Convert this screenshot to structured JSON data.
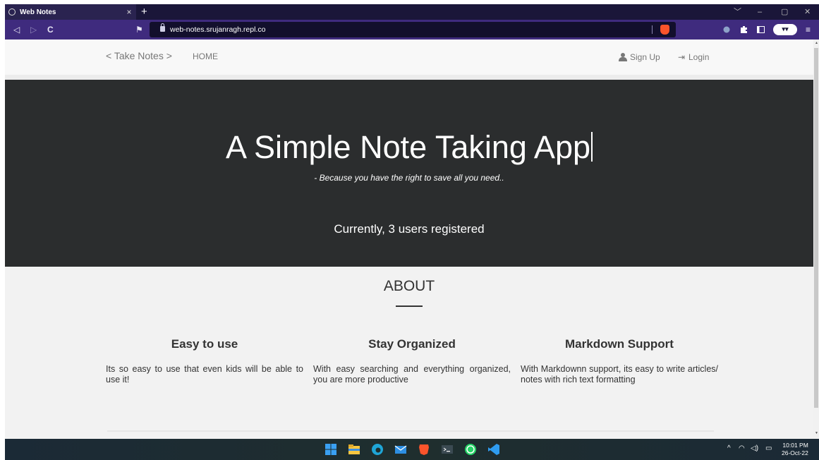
{
  "browser": {
    "tab_title": "Web Notes",
    "tab_close": "×",
    "new_tab": "+",
    "url": "web-notes.srujanragh.repl.co",
    "win_minimize": "–",
    "win_restore": "▢",
    "win_close": "✕",
    "win_chevron": "﹀",
    "back": "◁",
    "forward": "▷",
    "reload": "C",
    "bookmark": "⚑",
    "menu": "≡",
    "glasses": "▾▾"
  },
  "nav": {
    "brand": "< Take Notes >",
    "home": "HOME",
    "signup": "Sign Up",
    "login": "Login",
    "login_icon": "⇥"
  },
  "hero": {
    "title": "A Simple Note Taking App",
    "tagline": "- Because you have the right to save all you need..",
    "user_count": "Currently, 3 users registered"
  },
  "about": {
    "heading": "ABOUT",
    "features": [
      {
        "title": "Easy to use",
        "text": "Its so easy to use that even kids will be able to use it!"
      },
      {
        "title": "Stay Organized",
        "text": "With easy searching and everything organized, you are more productive"
      },
      {
        "title": "Markdown Support",
        "text": "With Markdownn support, its easy to write articles/ notes with rich text formatting"
      }
    ]
  },
  "taskbar": {
    "time": "10:01 PM",
    "date": "26-Oct-22",
    "tray_chevron": "^",
    "tray_wifi": "◠",
    "tray_volume": "◁)",
    "tray_battery": "▭"
  },
  "colors": {
    "hero_bg": "#2b2d2e",
    "tabbar_bg": "#1a1639",
    "toolbar_bg": "#3f2b7e"
  }
}
